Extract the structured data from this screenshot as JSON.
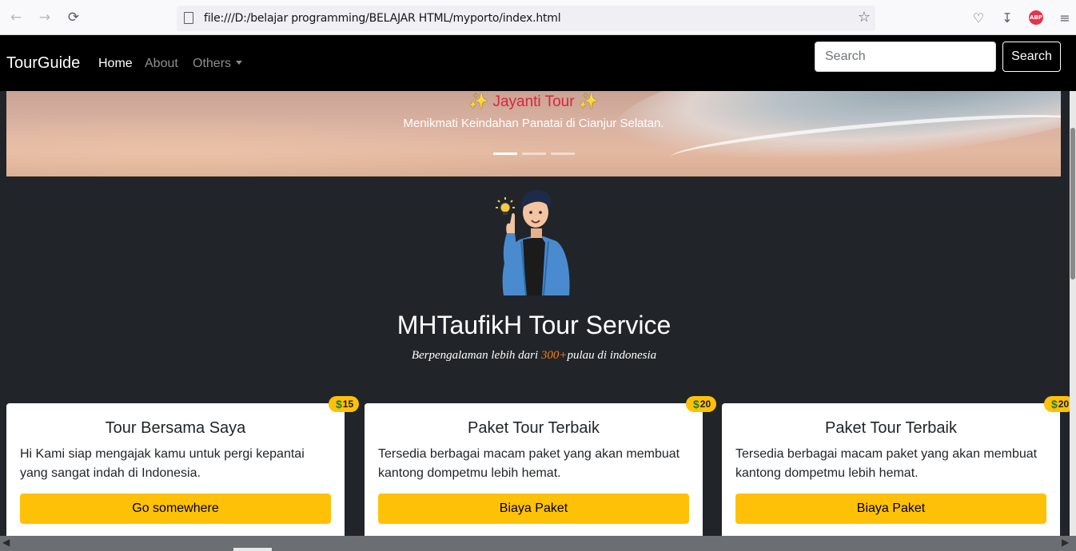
{
  "browser": {
    "url": "file:///D:/belajar programming/BELAJAR HTML/myporto/index.html",
    "back_icon": "arrow-left-icon",
    "forward_icon": "arrow-right-icon",
    "reload_icon": "reload-icon",
    "abp_label": "ABP"
  },
  "navbar": {
    "brand": "TourGuide",
    "links": [
      {
        "label": "Home",
        "active": true
      },
      {
        "label": "About",
        "active": false
      },
      {
        "label": "Others",
        "active": false
      }
    ],
    "search_placeholder": "Search",
    "search_button": "Search"
  },
  "carousel": {
    "title": "Jayanti Tour",
    "subtitle": "Menikmati Keindahan Panatai di Cianjur Selatan.",
    "active_slide": 1,
    "slide_count": 3
  },
  "hero": {
    "title": "MHTaufikH Tour Service",
    "subtitle_before": "Berpengalaman lebih dari ",
    "subtitle_highlight": "300+",
    "subtitle_after": "pulau di indonesia"
  },
  "cards": [
    {
      "price": "15",
      "title": "Tour Bersama Saya",
      "text": "Hi Kami siap mengajak kamu untuk pergi kepantai yang sangat indah di Indonesia.",
      "button": "Go somewhere"
    },
    {
      "price": "20",
      "title": "Paket Tour Terbaik",
      "text": "Tersedia berbagai macam paket yang akan membuat kantong dompetmu lebih hemat.",
      "button": "Biaya Paket"
    },
    {
      "price": "20",
      "title": "Paket Tour Terbaik",
      "text": "Tersedia berbagai macam paket yang akan membuat kantong dompetmu lebih hemat.",
      "button": "Biaya Paket"
    }
  ],
  "colors": {
    "navbar_bg": "#000000",
    "body_bg": "#212529",
    "button_warning": "#ffc107",
    "caption_title": "#d7263d",
    "highlight": "#fd7e14"
  }
}
